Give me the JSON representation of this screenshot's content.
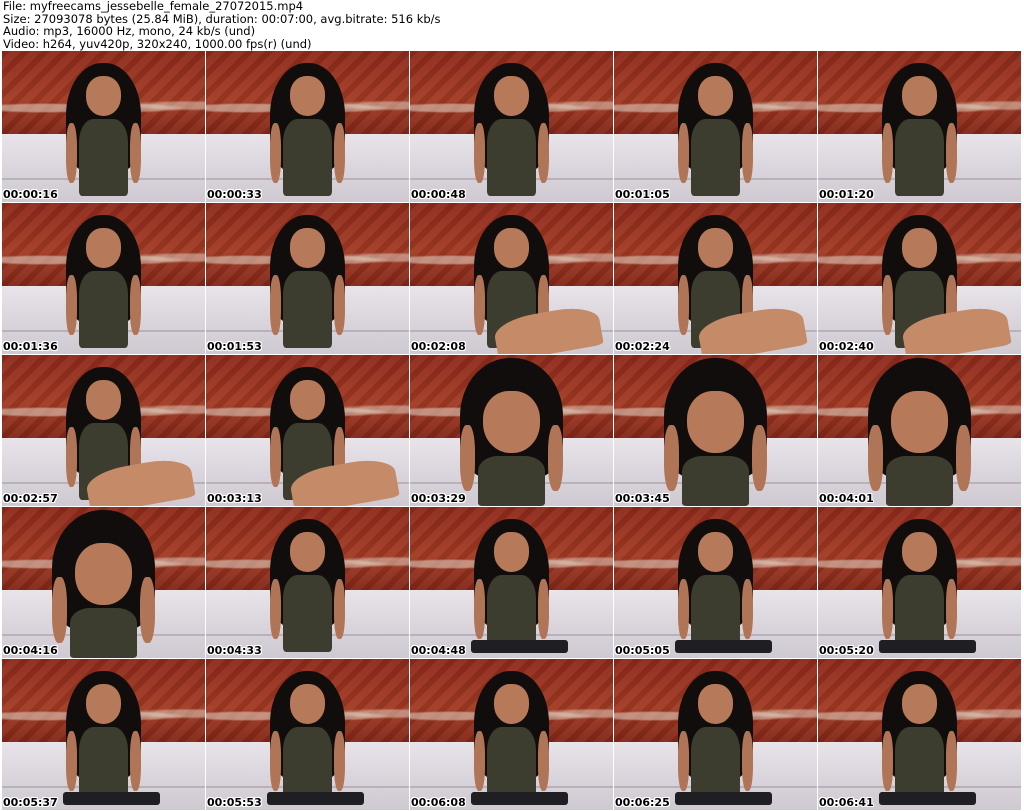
{
  "header": {
    "file_line": "File: myfreecams_jessebelle_female_27072015.mp4",
    "size_line": "Size: 27093078 bytes (25.84 MiB), duration: 00:07:00, avg.bitrate: 516 kb/s",
    "audio_line": "Audio: mp3, 16000 Hz, mono, 24 kb/s (und)",
    "video_line": "Video: h264, yuv420p, 320x240, 1000.00 fps(r) (und)"
  },
  "thumbnails": [
    {
      "timestamp": "00:00:16",
      "icon": "video-frame"
    },
    {
      "timestamp": "00:00:33",
      "icon": "video-frame"
    },
    {
      "timestamp": "00:00:48",
      "icon": "video-frame"
    },
    {
      "timestamp": "00:01:05",
      "icon": "video-frame"
    },
    {
      "timestamp": "00:01:20",
      "icon": "video-frame"
    },
    {
      "timestamp": "00:01:36",
      "icon": "video-frame"
    },
    {
      "timestamp": "00:01:53",
      "icon": "video-frame"
    },
    {
      "timestamp": "00:02:08",
      "icon": "video-frame"
    },
    {
      "timestamp": "00:02:24",
      "icon": "video-frame"
    },
    {
      "timestamp": "00:02:40",
      "icon": "video-frame"
    },
    {
      "timestamp": "00:02:57",
      "icon": "video-frame"
    },
    {
      "timestamp": "00:03:13",
      "icon": "video-frame"
    },
    {
      "timestamp": "00:03:29",
      "icon": "video-frame"
    },
    {
      "timestamp": "00:03:45",
      "icon": "video-frame"
    },
    {
      "timestamp": "00:04:01",
      "icon": "video-frame"
    },
    {
      "timestamp": "00:04:16",
      "icon": "video-frame"
    },
    {
      "timestamp": "00:04:33",
      "icon": "video-frame"
    },
    {
      "timestamp": "00:04:48",
      "icon": "video-frame"
    },
    {
      "timestamp": "00:05:05",
      "icon": "video-frame"
    },
    {
      "timestamp": "00:05:20",
      "icon": "video-frame"
    },
    {
      "timestamp": "00:05:37",
      "icon": "video-frame"
    },
    {
      "timestamp": "00:05:53",
      "icon": "video-frame"
    },
    {
      "timestamp": "00:06:08",
      "icon": "video-frame"
    },
    {
      "timestamp": "00:06:25",
      "icon": "video-frame"
    },
    {
      "timestamp": "00:06:41",
      "icon": "video-frame"
    }
  ],
  "colors": {
    "background": "#ffffff",
    "wall": "#9a3220",
    "sofa": "#e2dde4",
    "timestamp_text": "#000000"
  }
}
